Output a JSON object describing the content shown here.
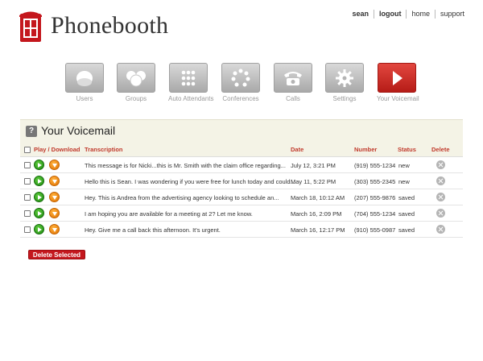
{
  "brand": {
    "name": "Phonebooth",
    "logo_icon": "phone-booth-icon",
    "accent": "#c4171d"
  },
  "topnav": [
    {
      "label": "sean"
    },
    {
      "label": "logout"
    },
    {
      "label": "home"
    },
    {
      "label": "support"
    }
  ],
  "nav": [
    {
      "label": "Users",
      "icon": "user-icon"
    },
    {
      "label": "Groups",
      "icon": "group-icon"
    },
    {
      "label": "Auto Attendants",
      "icon": "keypad-icon"
    },
    {
      "label": "Conferences",
      "icon": "conference-icon"
    },
    {
      "label": "Calls",
      "icon": "phone-icon"
    },
    {
      "label": "Settings",
      "icon": "gear-icon"
    },
    {
      "label": "Your Voicemail",
      "icon": "play-icon",
      "active": true
    }
  ],
  "panel": {
    "help": "?",
    "title": "Your Voicemail"
  },
  "table": {
    "columns": {
      "play_download": "Play / Download",
      "transcription": "Transcription",
      "date": "Date",
      "number": "Number",
      "status": "Status",
      "delete": "Delete"
    },
    "rows": [
      {
        "transcription": "This message is for Nicki...this is Mr. Smith with the claim office regarding...",
        "date": "July 12, 3:21 PM",
        "number": "(919) 555-1234",
        "status": "new"
      },
      {
        "transcription": "Hello this is Sean. I was wondering if you were free for lunch today and could...",
        "date": "May 11, 5:22 PM",
        "number": "(303) 555-2345",
        "status": "new"
      },
      {
        "transcription": "Hey. This is Andrea from the advertising agency looking to schedule an...",
        "date": "March 18, 10:12 AM",
        "number": "(207) 555-9876",
        "status": "saved"
      },
      {
        "transcription": "I am hoping you are available for a meeting at 2? Let me know.",
        "date": "March 16, 2:09 PM",
        "number": "(704) 555-1234",
        "status": "saved"
      },
      {
        "transcription": "Hey. Give me a call back this afternoon. It's urgent.",
        "date": "March 16, 12:17 PM",
        "number": "(910) 555-0987",
        "status": "saved"
      }
    ]
  },
  "actions": {
    "delete_selected": "Delete Selected"
  }
}
